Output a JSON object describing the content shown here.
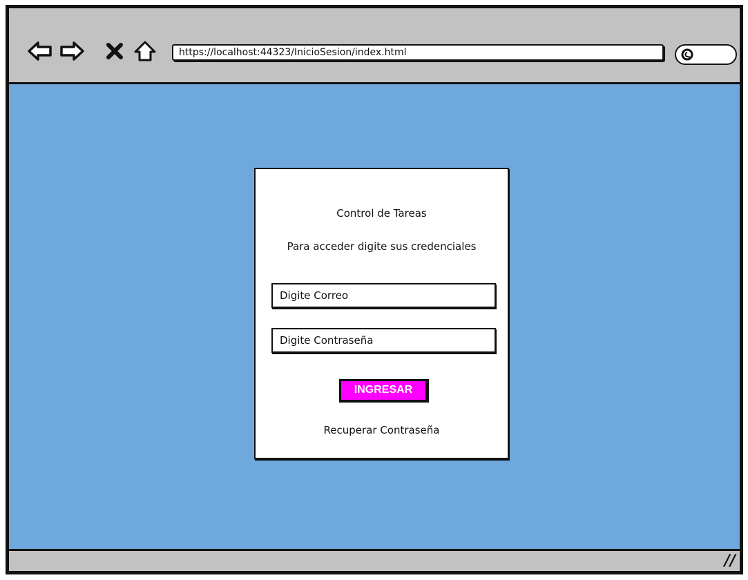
{
  "browser": {
    "url": "https://localhost:44323/InicioSesion/index.html",
    "icons": [
      "back-arrow-icon",
      "forward-arrow-icon",
      "close-icon",
      "home-icon",
      "search-icon",
      "resize-grip-icon"
    ],
    "resize_grip": "//"
  },
  "login": {
    "title": "Control de Tareas",
    "subtitle": "Para acceder digite sus credenciales",
    "email_placeholder": "Digite Correo",
    "password_placeholder": "Digite Contraseña",
    "submit_label": "INGRESAR",
    "recover_link": "Recuperar Contraseña"
  },
  "colors": {
    "page_background": "#6fa8dc",
    "chrome": "#c2c2c2",
    "button_accent": "#ff00ff"
  }
}
